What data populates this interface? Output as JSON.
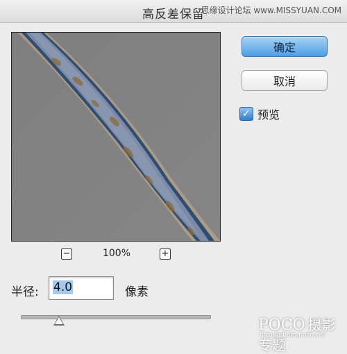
{
  "window": {
    "title": "高反差保留"
  },
  "watermark_top": "思缘设计论坛 www.MISSYUAN.COM",
  "buttons": {
    "ok_label": "确定",
    "cancel_label": "取消"
  },
  "preview_checkbox": {
    "label": "预览",
    "checked": true
  },
  "zoom": {
    "minus": "−",
    "plus": "+",
    "level": "100%"
  },
  "radius": {
    "label": "半径:",
    "value": "4.0",
    "unit": "像素"
  },
  "slider": {
    "position_fraction": 0.2
  },
  "watermark_bottom": {
    "logo": "POCO",
    "text": "摄影专题",
    "url": "http://photo.poco.cn/"
  }
}
